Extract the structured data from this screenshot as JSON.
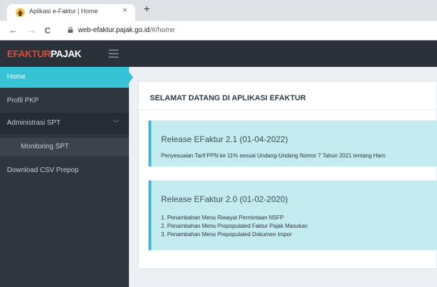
{
  "browser": {
    "tab_title": "Aplikasi e-Faktur | Home",
    "tab_close": "×",
    "new_tab": "+",
    "back": "←",
    "forward": "→",
    "reload": "C",
    "url_host": "web-efaktur.pajak.go.id",
    "url_path": "/#/home"
  },
  "header": {
    "logo_red": "EFAKTUR",
    "logo_white": "PAJAK"
  },
  "sidebar": {
    "items": [
      {
        "label": "Home"
      },
      {
        "label": "Profil PKP"
      },
      {
        "label": "Administrasi SPT",
        "chevron": "﹀"
      },
      {
        "label": "Monitoring SPT"
      },
      {
        "label": "Download CSV Prepop"
      }
    ]
  },
  "main": {
    "title": "SELAMAT DATANG DI APLIKASI EFAKTUR",
    "releases": [
      {
        "title": "Release EFaktur 2.1 (01-04-2022)",
        "lines": [
          "Penyesuaian Tarif PPN ke 11% sesuai Undang-Undang Nomor 7 Tahun 2021 tentang Harn"
        ]
      },
      {
        "title": "Release EFaktur 2.0 (01-02-2020)",
        "lines": [
          "1. Penambahan Menu Riwayat Permintaan NSFP",
          "2. Penambahan Menu Prepopulated Faktur Pajak Masukan",
          "3. Penambahan Menu Prepopulated Dokumen Impor"
        ]
      }
    ]
  },
  "colors": {
    "accent": "#37c3d6",
    "header_bg": "#2b3138",
    "sidebar_bg": "#2f363e",
    "logo_red": "#dd4b39",
    "callout_bg": "#c4ebf0"
  }
}
